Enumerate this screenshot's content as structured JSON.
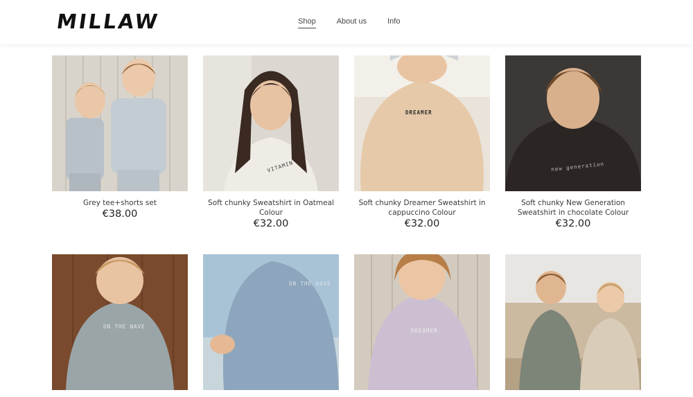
{
  "brand": {
    "logo": "MILLAW"
  },
  "nav": {
    "items": [
      "Shop",
      "About us",
      "Info"
    ],
    "active": "Shop"
  },
  "products": [
    {
      "title": "Grey tee+shorts set",
      "price": "€38.00",
      "shirt_text": ""
    },
    {
      "title": "Soft chunky Sweatshirt in Oatmeal Colour",
      "price": "€32.00",
      "shirt_text": "VITAMIN"
    },
    {
      "title": "Soft chunky Dreamer Sweatshirt in cappuccino Colour",
      "price": "€32.00",
      "shirt_text": "DREAMER"
    },
    {
      "title": "Soft chunky New Generation Sweatshirt in chocolate Colour",
      "price": "€32.00",
      "shirt_text": "new generation"
    },
    {
      "title": "",
      "price": "",
      "shirt_text": "ON THE WAVE"
    },
    {
      "title": "",
      "price": "",
      "shirt_text": "ON THE WAVE"
    },
    {
      "title": "",
      "price": "",
      "shirt_text": "DREAMER"
    },
    {
      "title": "",
      "price": "",
      "shirt_text": ""
    }
  ]
}
